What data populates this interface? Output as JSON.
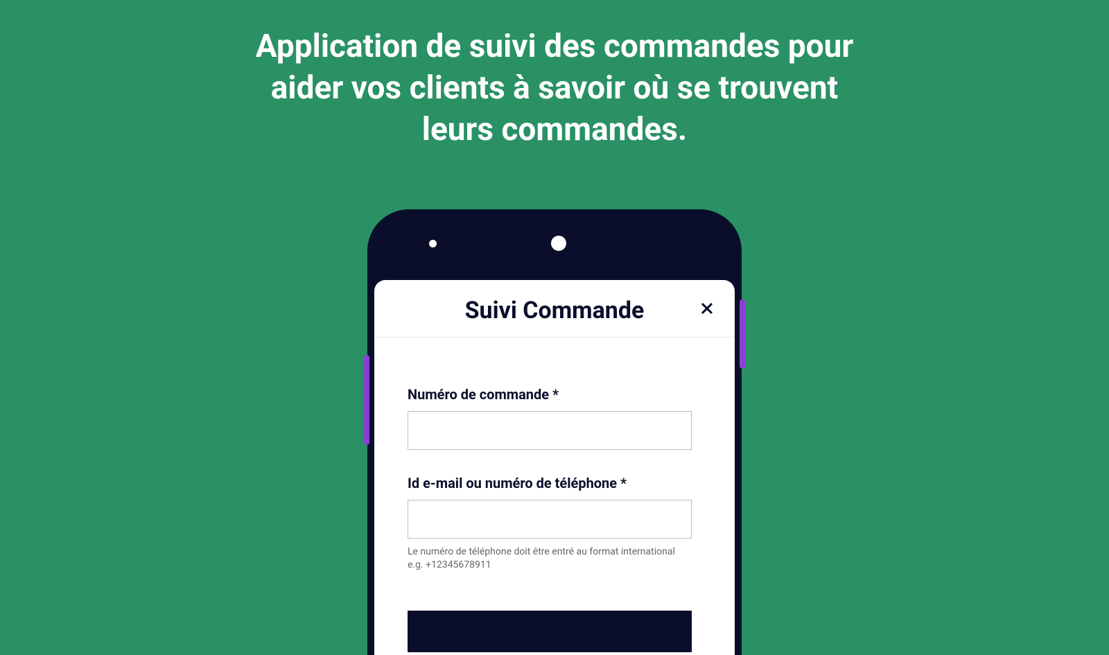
{
  "hero": {
    "title": "Application de suivi des commandes pour aider vos clients à savoir où se trouvent leurs commandes."
  },
  "screen": {
    "title": "Suivi Commande",
    "form": {
      "order_number": {
        "label": "Numéro de commande *",
        "value": ""
      },
      "email_or_phone": {
        "label": "Id e-mail ou numéro de téléphone *",
        "value": "",
        "hint": "Le numéro de téléphone doit être entré au format international e.g. +12345678911"
      }
    }
  }
}
